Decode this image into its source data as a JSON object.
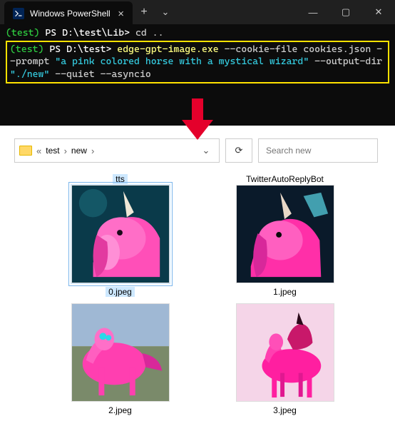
{
  "window": {
    "tab_title": "Windows PowerShell",
    "close_glyph": "×",
    "new_glyph": "+",
    "dd_glyph": "⌄",
    "min_glyph": "—",
    "max_glyph": "▢",
    "win_close": "✕"
  },
  "term": {
    "line1_env": "(test)",
    "line1_ps": " PS ",
    "line1_path": "D:\\test\\Lib>",
    "line1_cmd": " cd ..",
    "cmd_env": "(test)",
    "cmd_ps": " PS ",
    "cmd_path": "D:\\test>",
    "cmd_exe": " edge-gpt-image.exe",
    "cmd_flag1": " --cookie-file ",
    "cmd_arg1": "cookies.json",
    "cmd_flag2": " --prompt ",
    "cmd_str": "\"a pink colored horse with a mystical wizard\"",
    "cmd_flag3": " --output-dir ",
    "cmd_str2": "\"./new\"",
    "cmd_rest": " --quiet --asyncio"
  },
  "explorer": {
    "crumb_prefix": "«",
    "crumb1": "test",
    "crumb2": "new",
    "sep": "›",
    "path_dd": "⌄",
    "refresh": "⟳",
    "search_placeholder": "Search new",
    "items": [
      {
        "name": "tts",
        "file": "0.jpeg",
        "selected": true
      },
      {
        "name": "TwitterAutoReplyBot",
        "file": "1.jpeg",
        "selected": false
      },
      {
        "name": "",
        "file": "2.jpeg",
        "selected": false
      },
      {
        "name": "",
        "file": "3.jpeg",
        "selected": false
      }
    ]
  }
}
